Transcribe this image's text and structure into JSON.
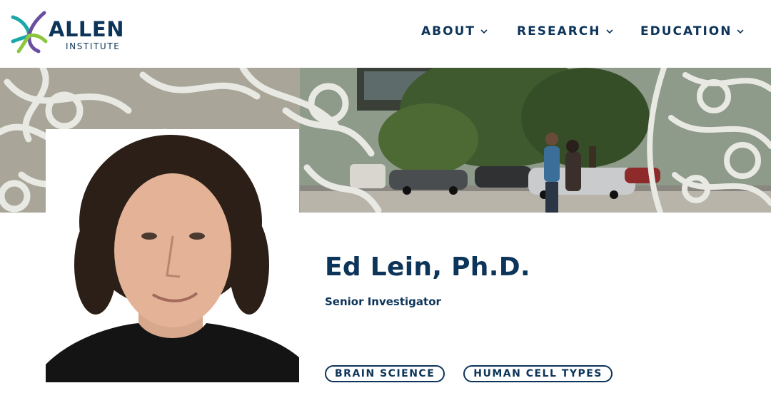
{
  "brand": {
    "name": "ALLEN",
    "subtitle": "INSTITUTE",
    "colors": {
      "teal": "#1aa7a8",
      "purple": "#6a4fa1",
      "green": "#8cc63f",
      "navy": "#0d3459"
    }
  },
  "nav": {
    "items": [
      {
        "label": "ABOUT",
        "icon": "chevron-down-icon"
      },
      {
        "label": "RESEARCH",
        "icon": "chevron-down-icon"
      },
      {
        "label": "EDUCATION",
        "icon": "chevron-down-icon"
      }
    ]
  },
  "profile": {
    "name": "Ed Lein, Ph.D.",
    "title": "Senior Investigator",
    "tags": [
      "BRAIN SCIENCE",
      "HUMAN CELL TYPES"
    ]
  },
  "colors": {
    "text": "#0d3459",
    "background": "#ffffff"
  }
}
